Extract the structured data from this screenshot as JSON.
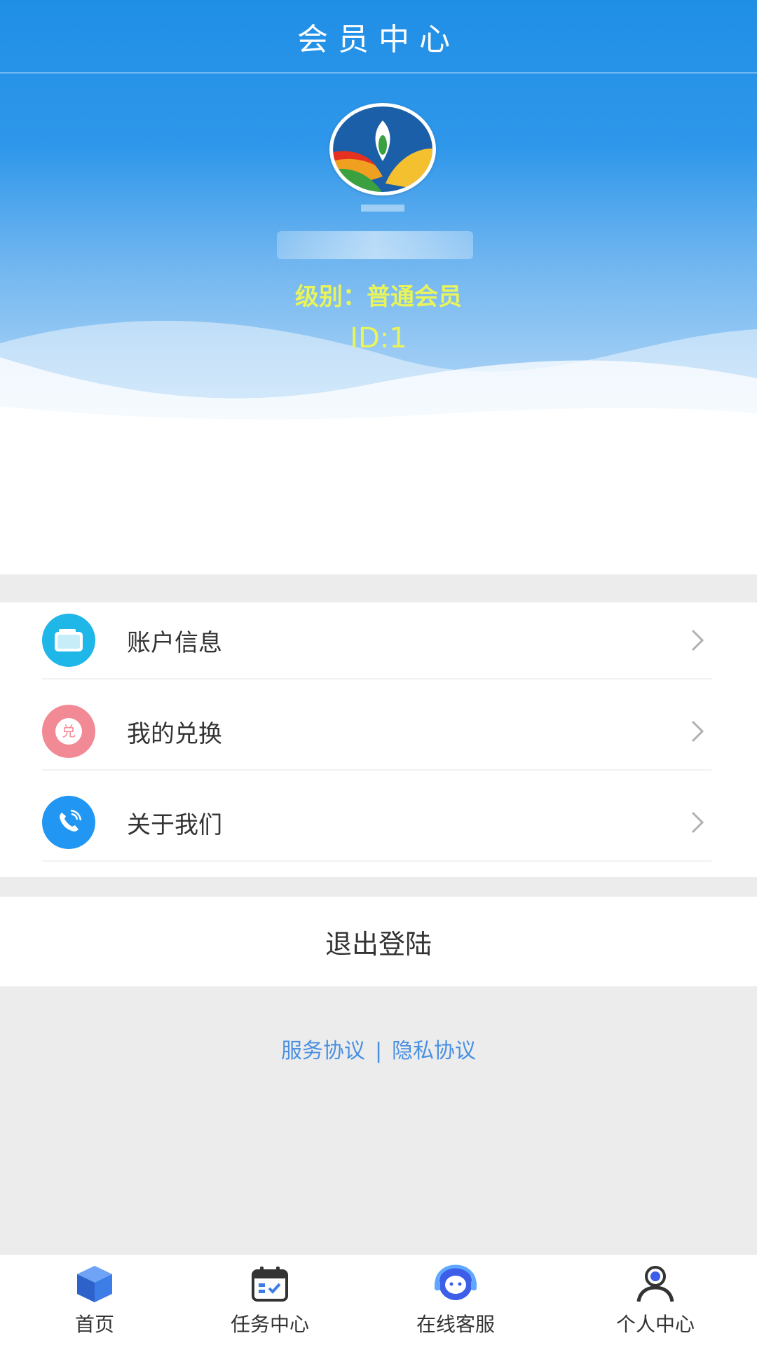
{
  "header": {
    "title": "会员中心"
  },
  "profile": {
    "username": "",
    "level_label": "级别：普通会员",
    "id_label": "ID:1"
  },
  "menu": {
    "items": [
      {
        "label": "账户信息",
        "icon": "wallet-icon",
        "color": "#1fb6e8"
      },
      {
        "label": "我的兑换",
        "icon": "exchange-icon",
        "color": "#f28a95"
      },
      {
        "label": "关于我们",
        "icon": "phone-icon",
        "color": "#2196f3"
      }
    ]
  },
  "actions": {
    "logout_label": "退出登陆"
  },
  "footer_links": {
    "service": "服务协议",
    "separator": "|",
    "privacy": "隐私协议"
  },
  "tabbar": {
    "items": [
      {
        "label": "首页",
        "icon": "cube-icon"
      },
      {
        "label": "任务中心",
        "icon": "calendar-icon"
      },
      {
        "label": "在线客服",
        "icon": "support-icon"
      },
      {
        "label": "个人中心",
        "icon": "user-icon"
      }
    ]
  },
  "colors": {
    "primary": "#1f8fe6",
    "accent_text": "#e8f45a",
    "link": "#4a90e2"
  }
}
